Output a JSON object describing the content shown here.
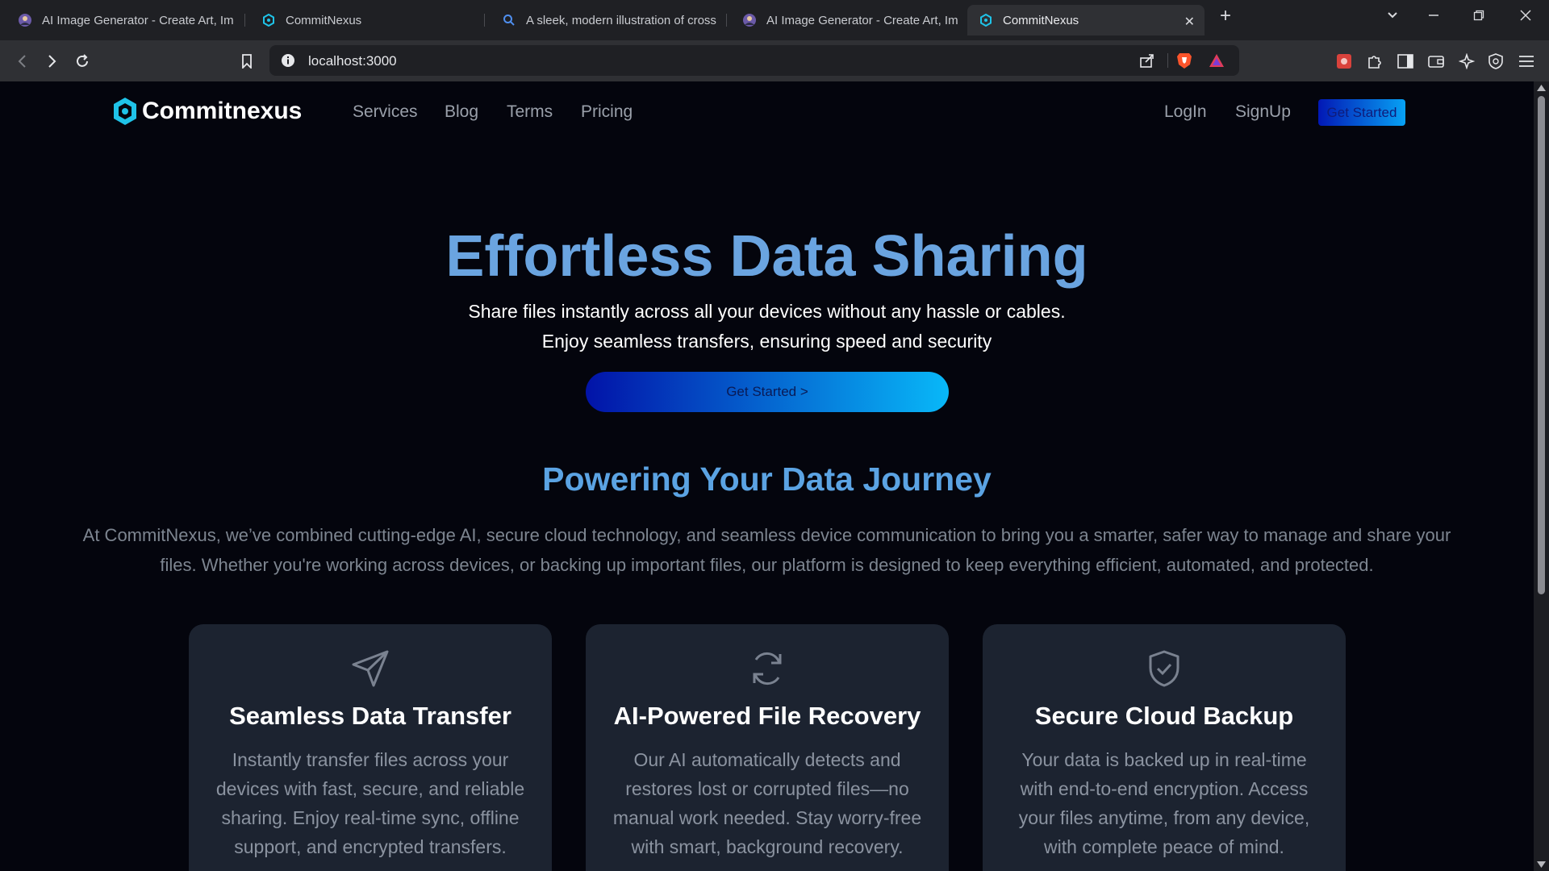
{
  "browser": {
    "tabs": [
      {
        "label": "AI Image Generator - Create Art, Im",
        "icon": "ai-avatar-icon"
      },
      {
        "label": "CommitNexus",
        "icon": "hexagon-logo-icon"
      },
      {
        "label": "A sleek, modern illustration of cross",
        "icon": "search-icon"
      },
      {
        "label": "AI Image Generator - Create Art, Im",
        "icon": "ai-avatar-icon"
      },
      {
        "label": "CommitNexus",
        "icon": "hexagon-logo-icon",
        "active": true
      }
    ],
    "url": "localhost:3000"
  },
  "site": {
    "logo_text": "Commitnexus",
    "nav": {
      "links": [
        "Services",
        "Blog",
        "Terms",
        "Pricing"
      ],
      "login": "LogIn",
      "signup": "SignUp",
      "cta": "Get Started"
    },
    "hero": {
      "title": "Effortless Data Sharing",
      "subtitle_line1": "Share files instantly across all your devices without any hassle or cables.",
      "subtitle_line2": "Enjoy seamless transfers, ensuring speed and security",
      "button": "Get Started >"
    },
    "journey": {
      "title": "Powering Your Data Journey",
      "text": "At CommitNexus, we’ve combined cutting-edge AI, secure cloud technology, and seamless device communication to bring you a smarter, safer way to manage and share your files. Whether you're working across devices, or backing up important files, our platform is designed to keep everything efficient, automated, and protected."
    },
    "features": [
      {
        "icon": "send-icon",
        "title": "Seamless Data Transfer",
        "text": "Instantly transfer files across your devices with fast, secure, and reliable sharing. Enjoy real-time sync, offline support, and encrypted transfers."
      },
      {
        "icon": "refresh-icon",
        "title": "AI-Powered File Recovery",
        "text": "Our AI automatically detects and restores lost or corrupted files—no manual work needed. Stay worry-free with smart, background recovery."
      },
      {
        "icon": "shield-check-icon",
        "title": "Secure Cloud Backup",
        "text": "Your data is backed up in real-time with end-to-end encryption. Access your files anytime, from any device, with complete peace of mind."
      }
    ]
  },
  "colors": {
    "accent_blue": "#6aa4e0",
    "gradient_start": "#0213a8",
    "gradient_end": "#08b8f8",
    "card_bg": "#1c2330",
    "page_bg": "#04050d"
  }
}
